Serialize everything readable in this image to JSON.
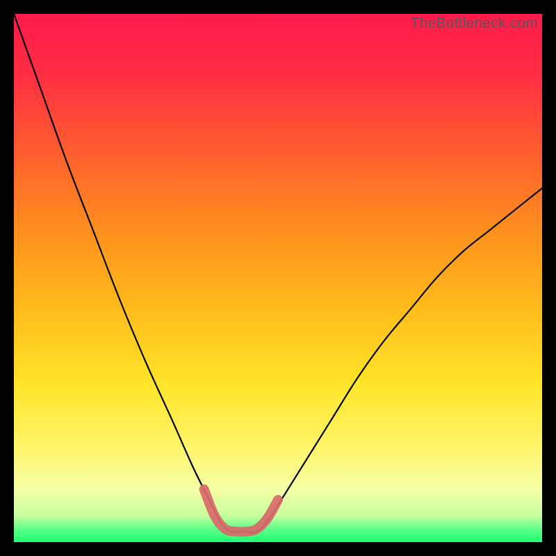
{
  "watermark": "TheBottleneck.com",
  "colors": {
    "frame_bg": "#000000",
    "gradient_stops": [
      {
        "offset": 0.0,
        "color": "#ff1a4b"
      },
      {
        "offset": 0.12,
        "color": "#ff2f42"
      },
      {
        "offset": 0.25,
        "color": "#ff5a2f"
      },
      {
        "offset": 0.4,
        "color": "#ff8c1f"
      },
      {
        "offset": 0.55,
        "color": "#ffb91a"
      },
      {
        "offset": 0.7,
        "color": "#ffe428"
      },
      {
        "offset": 0.82,
        "color": "#fff569"
      },
      {
        "offset": 0.9,
        "color": "#f6ffa5"
      },
      {
        "offset": 0.95,
        "color": "#c8ff9e"
      },
      {
        "offset": 0.975,
        "color": "#5eff88"
      },
      {
        "offset": 1.0,
        "color": "#1eff75"
      }
    ],
    "curve_stroke": "#000000",
    "highlight_stroke": "#d86a6a"
  },
  "chart_data": {
    "type": "line",
    "title": "",
    "xlabel": "",
    "ylabel": "",
    "xlim": [
      0,
      100
    ],
    "ylim": [
      0,
      100
    ],
    "x": [
      0,
      5,
      10,
      15,
      20,
      25,
      30,
      34,
      37,
      39,
      41,
      43,
      46,
      48,
      50,
      55,
      60,
      65,
      70,
      75,
      80,
      85,
      90,
      95,
      100
    ],
    "values": [
      100,
      86,
      72,
      59,
      46,
      34,
      23,
      14,
      8,
      4,
      2,
      2,
      2,
      4,
      7,
      15,
      23,
      31,
      38,
      44,
      50,
      55,
      59,
      63,
      67
    ],
    "series": [
      {
        "name": "bottleneck-curve",
        "x": [
          0,
          5,
          10,
          15,
          20,
          25,
          30,
          34,
          37,
          39,
          41,
          43,
          46,
          48,
          50,
          55,
          60,
          65,
          70,
          75,
          80,
          85,
          90,
          95,
          100
        ],
        "values": [
          100,
          86,
          72,
          59,
          46,
          34,
          23,
          14,
          8,
          4,
          2,
          2,
          2,
          4,
          7,
          15,
          23,
          31,
          38,
          44,
          50,
          55,
          59,
          63,
          67
        ]
      },
      {
        "name": "optimal-highlight",
        "x": [
          36,
          38,
          40,
          42,
          44,
          46,
          48,
          50
        ],
        "values": [
          10,
          5,
          2.5,
          2,
          2,
          2.5,
          4.5,
          8
        ]
      }
    ],
    "annotations": []
  }
}
